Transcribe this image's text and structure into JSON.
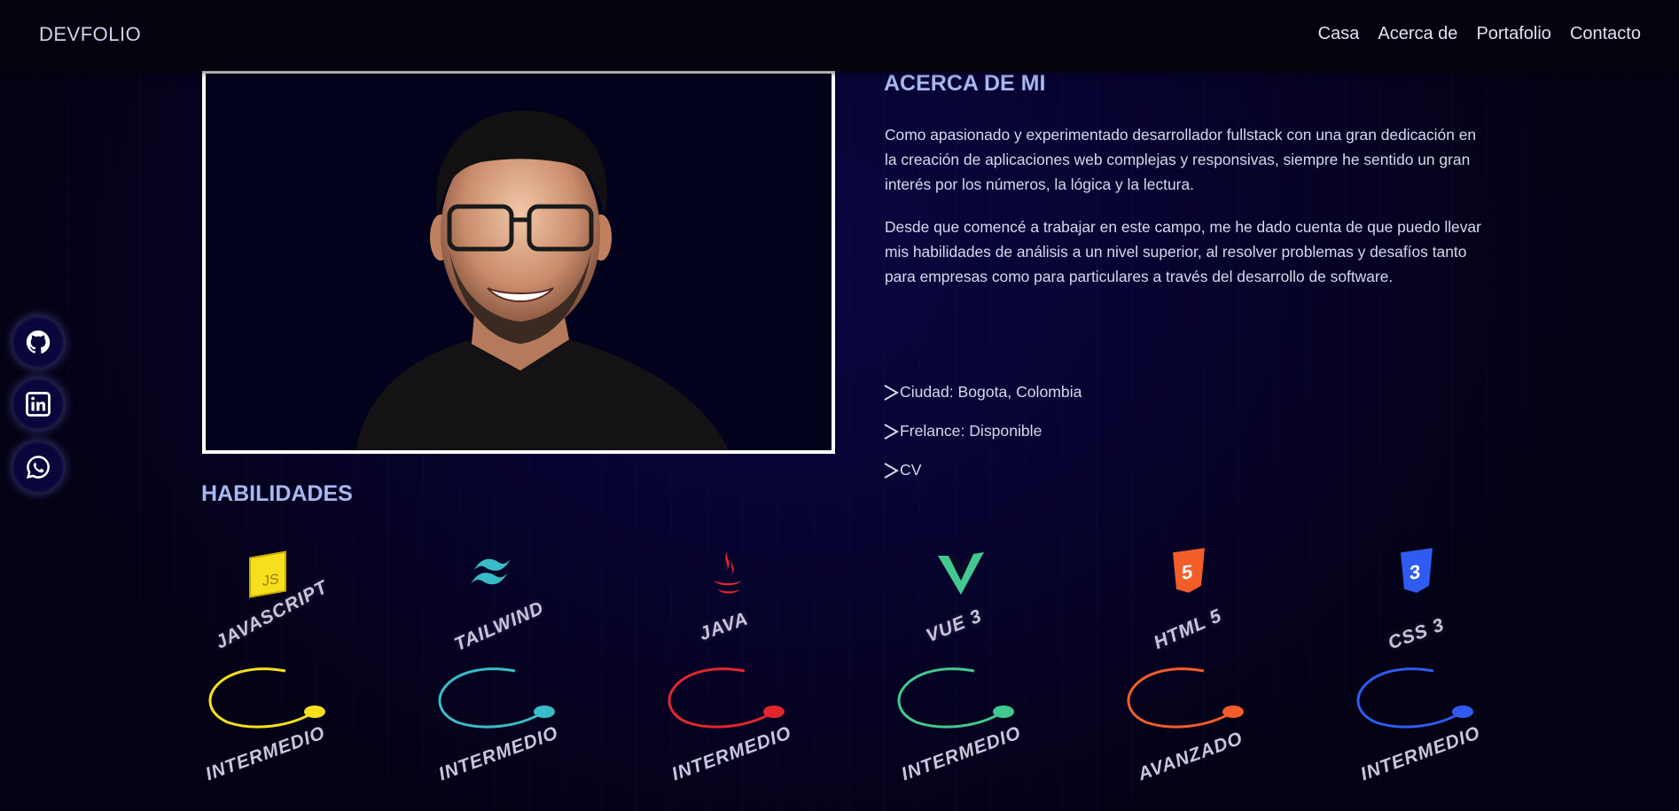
{
  "nav": {
    "brand": "DEVFOLIO",
    "links": [
      "Casa",
      "Acerca de",
      "Portafolio",
      "Contacto"
    ]
  },
  "social": [
    "github-icon",
    "linkedin-icon",
    "whatsapp-icon"
  ],
  "about": {
    "title": "ACERCA DE MI",
    "paragraphs": [
      "Como apasionado y experimentado desarrollador fullstack con una gran dedicación en la creación de aplicaciones web complejas y responsivas, siempre he sentido un gran interés por los números, la lógica y la lectura.",
      "Desde que comencé a trabajar en este campo, me he dado cuenta de que puedo llevar mis habilidades de análisis a un nivel superior, al resolver problemas y desafíos tanto para empresas como para particulares a través del desarrollo de software."
    ],
    "info": [
      "Ciudad: Bogota, Colombia",
      "Frelance: Disponible",
      "CV"
    ]
  },
  "skills": {
    "title": "HABILIDADES",
    "items": [
      {
        "name": "JAVASCRIPT",
        "level": "INTERMEDIO",
        "icon": "javascript-icon",
        "color": "#f7df1e"
      },
      {
        "name": "TAILWIND",
        "level": "INTERMEDIO",
        "icon": "tailwind-icon",
        "color": "#38bdc8"
      },
      {
        "name": "JAVA",
        "level": "INTERMEDIO",
        "icon": "java-icon",
        "color": "#e3262e"
      },
      {
        "name": "VUE 3",
        "level": "INTERMEDIO",
        "icon": "vue-icon",
        "color": "#42c98f"
      },
      {
        "name": "HTML 5",
        "level": "AVANZADO",
        "icon": "html5-icon",
        "color": "#f35d2a"
      },
      {
        "name": "CSS 3",
        "level": "INTERMEDIO",
        "icon": "css3-icon",
        "color": "#2f5bf0"
      }
    ]
  },
  "colors": {
    "background": "#070330",
    "navbar": "#04030c",
    "accent_title": "#a8b8f0"
  }
}
